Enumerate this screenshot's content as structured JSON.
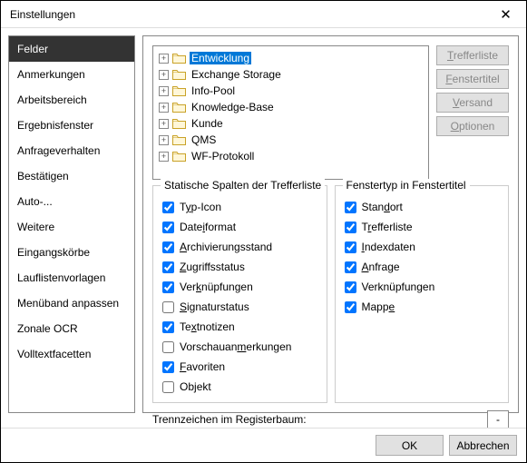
{
  "window": {
    "title": "Einstellungen",
    "close": "✕"
  },
  "sidebar": {
    "items": [
      {
        "label": "Felder",
        "sel": true
      },
      {
        "label": "Anmerkungen"
      },
      {
        "label": "Arbeitsbereich"
      },
      {
        "label": "Ergebnisfenster"
      },
      {
        "label": "Anfrageverhalten"
      },
      {
        "label": "Bestätigen"
      },
      {
        "label": "Auto-..."
      },
      {
        "label": "Weitere"
      },
      {
        "label": "Eingangskörbe"
      },
      {
        "label": "Lauflistenvorlagen"
      },
      {
        "label": "Menüband anpassen"
      },
      {
        "label": "Zonale OCR"
      },
      {
        "label": "Volltextfacetten"
      }
    ]
  },
  "tree": [
    {
      "label": "Entwicklung",
      "hl": true
    },
    {
      "label": "Exchange Storage"
    },
    {
      "label": "Info-Pool"
    },
    {
      "label": "Knowledge-Base"
    },
    {
      "label": "Kunde"
    },
    {
      "label": "QMS"
    },
    {
      "label": "WF-Protokoll"
    }
  ],
  "buttons": {
    "b0": "Trefferliste",
    "b0u": "T",
    "b1": "Fenstertitel",
    "b1u": "F",
    "b2": "Versand",
    "b2u": "V",
    "b3": "Optionen",
    "b3u": "O"
  },
  "group1": {
    "title": "Statische Spalten der Trefferliste",
    "items": [
      {
        "label": "Typ-Icon",
        "u": "y",
        "c": true
      },
      {
        "label": "Dateiformat",
        "u": "i",
        "c": true
      },
      {
        "label": "Archivierungsstand",
        "u": "A",
        "c": true
      },
      {
        "label": "Zugriffsstatus",
        "u": "Z",
        "c": true
      },
      {
        "label": "Verknüpfungen",
        "u": "k",
        "c": true
      },
      {
        "label": "Signaturstatus",
        "u": "S",
        "c": false
      },
      {
        "label": "Textnotizen",
        "u": "x",
        "c": true
      },
      {
        "label": "Vorschauanmerkungen",
        "u": "m",
        "c": false
      },
      {
        "label": "Favoriten",
        "u": "F",
        "c": true
      },
      {
        "label": "Objekt",
        "u": "j",
        "c": false
      }
    ]
  },
  "group2": {
    "title": "Fenstertyp in Fenstertitel",
    "items": [
      {
        "label": "Standort",
        "u": "d",
        "c": true
      },
      {
        "label": "Trefferliste",
        "u": "r",
        "c": true
      },
      {
        "label": "Indexdaten",
        "u": "I",
        "c": true
      },
      {
        "label": "Anfrage",
        "u": "A",
        "c": true
      },
      {
        "label": "Verknüpfungen",
        "u": "g",
        "c": true
      },
      {
        "label": "Mappe",
        "u": "e",
        "c": true
      }
    ]
  },
  "sep": {
    "label": "Trennzeichen im Registerbaum:",
    "value": "-"
  },
  "footer": {
    "ok": "OK",
    "cancel": "Abbrechen"
  }
}
